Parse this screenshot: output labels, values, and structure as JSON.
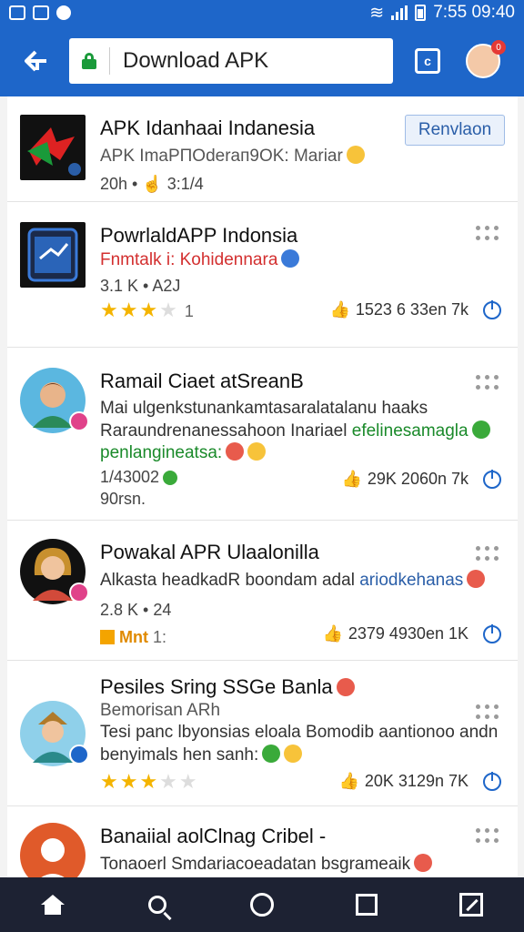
{
  "status": {
    "time": "7:55 09:40"
  },
  "toolbar": {
    "url_text": "Download APK",
    "tab_count": "c",
    "avatar_badge": "0"
  },
  "items": [
    {
      "title": "APK Idanhaai Indanesia",
      "line1": "APK ImaPПOderaп9OK: Mariar",
      "meta": "20h • ☝ 3:1/4",
      "action": "Renvlaon"
    },
    {
      "title": "PowrlaldAPP Indonsia",
      "line1": "Fnmtalk i: Kohidennara",
      "meta": "3.1 K • A2J",
      "rating": "1",
      "stats": "1523 6 33en 7k"
    },
    {
      "title": "Ramail Ciaet atSreanB",
      "line1": "Mai ulgenkstunankamtasaralatalanu haaks",
      "line2_a": "Raraundrenanessahoon Inariael ",
      "line2_b": "efelinesamagla",
      "line3": "penlangineatsa:",
      "meta1": "1/43002",
      "meta2": "90rsn.",
      "stats": "29K 2060n 7k"
    },
    {
      "title": "Powakal APR Ulaalonilla",
      "line1_a": "Alkasta headkadR boondam adal ",
      "line1_b": "ariodkehanas",
      "meta": "2.8 K • 24",
      "badge": "Mnt",
      "badge_num": "1:",
      "stats": "2379 4930en 1K"
    },
    {
      "title": "Pesiles Sring SSGe Banla",
      "subtitle": "Bemorisan ARh",
      "line1": "Tesi panc lbyonsias eloala Bomodib aantionoo andn",
      "line2": "benyimals hen sanh:",
      "stats": "20K 3129n 7K"
    },
    {
      "title": "Banaiial aolClnag Cribel -",
      "line1": "Tonaoerl Smdariacoeadatan bsgrameaik"
    }
  ]
}
